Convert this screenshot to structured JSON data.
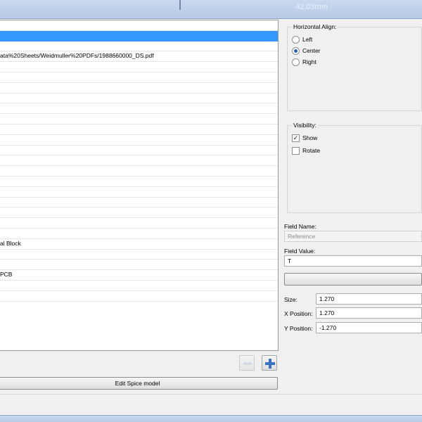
{
  "topbar": {
    "faded_text": "42.03mm"
  },
  "fields_list": {
    "rows": [
      "",
      "",
      "",
      "ata%20Sheets/Weidmuller%20PDFs/1988660000_DS.pdf",
      "",
      "",
      "",
      "",
      "",
      "",
      "",
      "",
      "",
      "",
      "",
      "",
      "",
      "",
      "",
      "",
      "",
      "al Block",
      "",
      "",
      "PCB",
      "",
      ""
    ],
    "selected_index": 1
  },
  "buttons": {
    "remove_icon": "minus-icon",
    "add_icon": "plus-icon",
    "edit_spice": "Edit Spice model"
  },
  "horizontal_align": {
    "title": "Horizontal Align:",
    "options": [
      "Left",
      "Center",
      "Right"
    ],
    "selected": "Center"
  },
  "visibility": {
    "title": "Visibility:",
    "show_label": "Show",
    "show_checked": true,
    "rotate_label": "Rotate",
    "rotate_checked": false
  },
  "field_name": {
    "label": "Field Name:",
    "value": "Reference"
  },
  "field_value": {
    "label": "Field Value:",
    "value": "T"
  },
  "size": {
    "label": "Size:",
    "value": "1.270"
  },
  "x_position": {
    "label": "X Position:",
    "value": "1.270"
  },
  "y_position": {
    "label": "Y Position:",
    "value": "-1.270"
  }
}
